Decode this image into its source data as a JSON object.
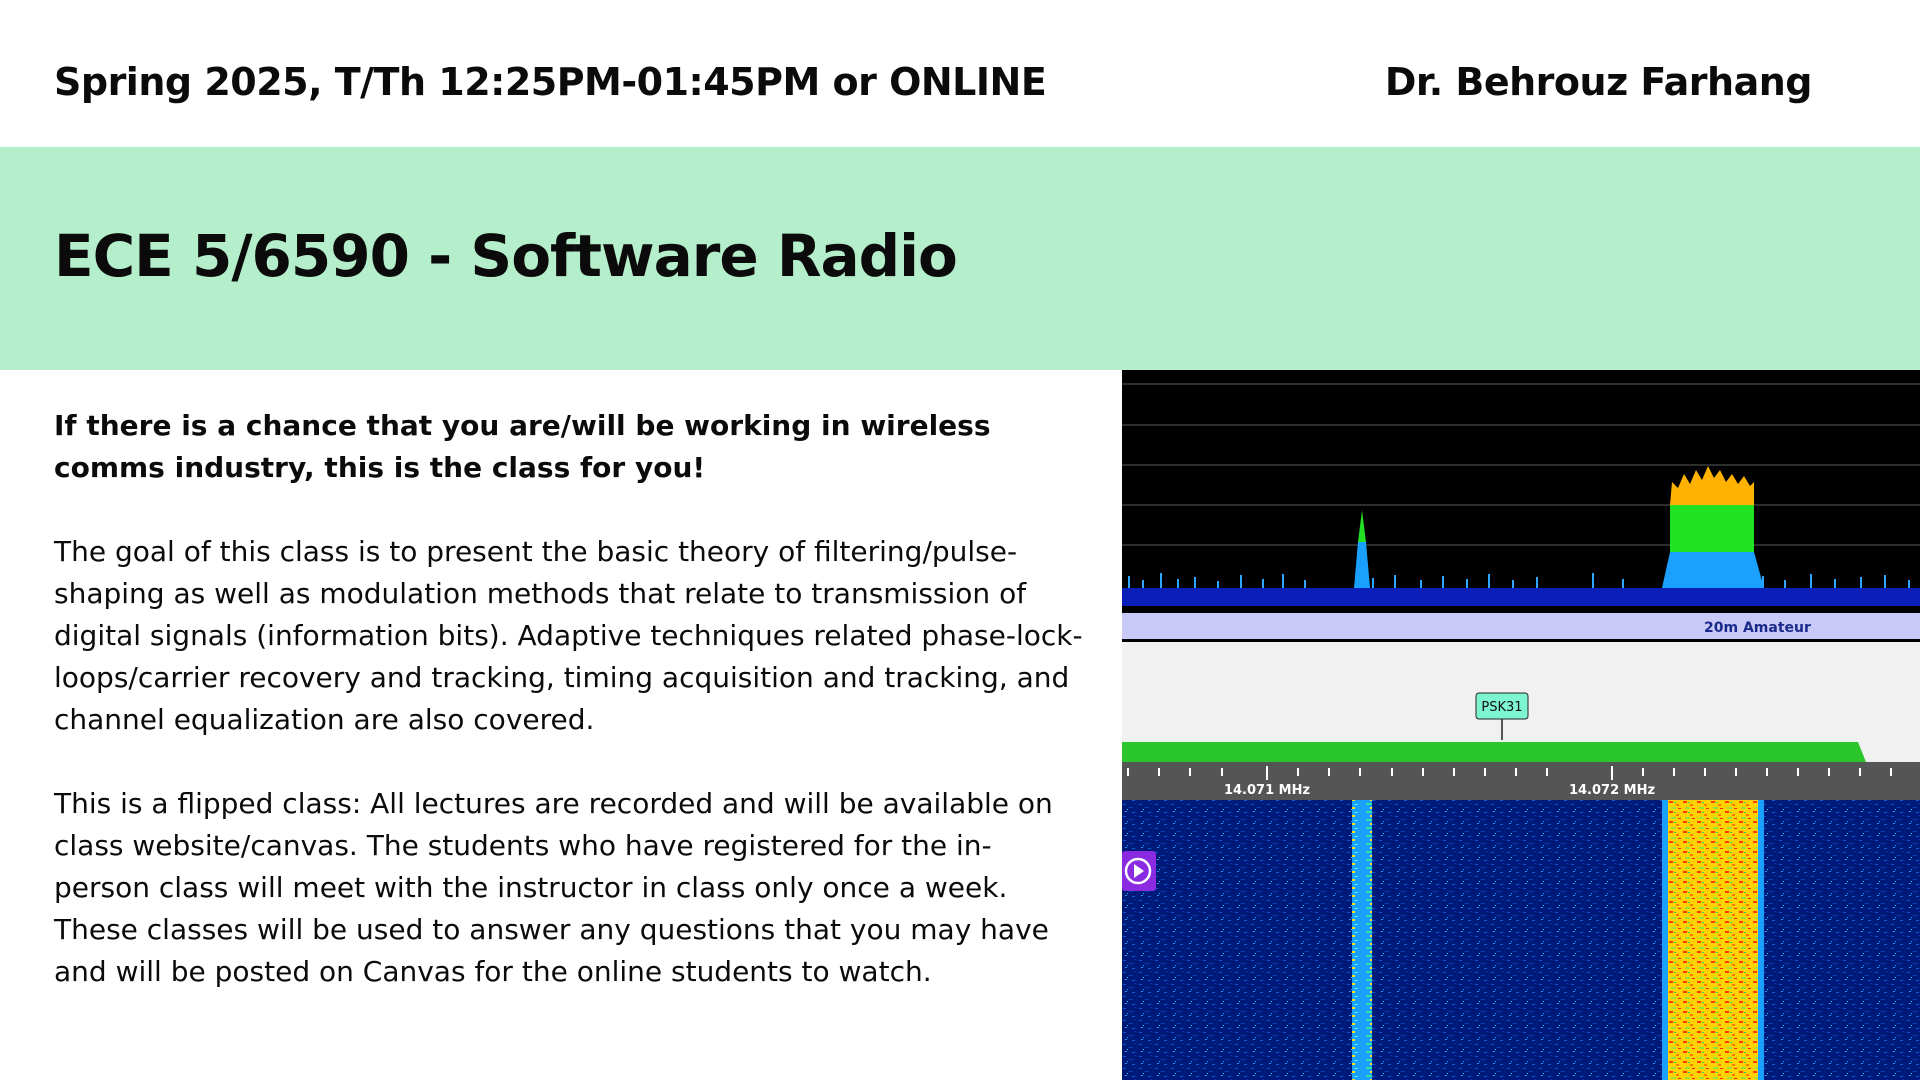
{
  "header": {
    "term": "Spring 2025, T/Th 12:25PM-01:45PM or ONLINE",
    "instructor": "Dr. Behrouz Farhang"
  },
  "banner": {
    "course_title": "ECE 5/6590 - Software Radio"
  },
  "content": {
    "lead": "If there is a chance that you are/will be working in wireless comms industry, this is the class for you!",
    "paragraph_1": "The goal of this class is to present the basic theory of filtering/pulse-shaping as well as modulation methods that relate to transmission of digital signals (information bits). Adaptive techniques related phase-lock-loops/carrier recovery and tracking, timing acquisition and tracking, and channel equalization are also covered.",
    "paragraph_2": "This is a flipped class: All lectures are recorded and will be available on class website/canvas. The students who have registered for the in-person class will meet with the instructor in class only once a week. These classes will be used to answer any questions that you may have and will be posted on Canvas for the online students to watch."
  },
  "sdr": {
    "band_label": "20m Amateur",
    "marker_label": "PSK31",
    "freq_1": "14.071 MHz",
    "freq_2": "14.072 MHz",
    "play_icon": "play-circle-icon",
    "colors": {
      "spectrum_bg": "#000000",
      "noise": "#0a1fb8",
      "band_bar": "#c9c9f7",
      "marker": "#7df5d0",
      "passband": "#2bc62b",
      "play": "#8a2be2"
    }
  }
}
